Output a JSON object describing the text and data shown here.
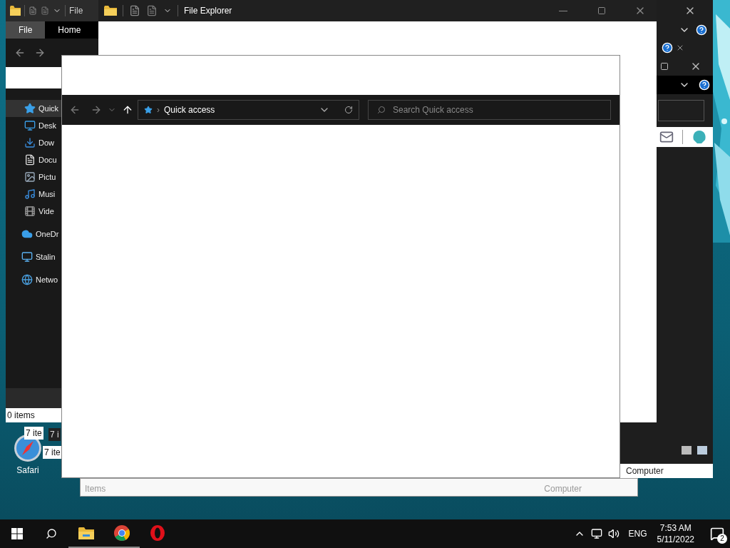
{
  "back_window": {
    "title": "File",
    "ribbon_tabs": [
      {
        "label": "File",
        "selected": true
      },
      {
        "label": "Home",
        "selected": false
      }
    ],
    "nav_items": [
      {
        "label": "Quick",
        "kind": "star",
        "selected": true
      },
      {
        "label": "Desk",
        "kind": "desktop",
        "selected": false
      },
      {
        "label": "Dow",
        "kind": "download",
        "selected": false
      },
      {
        "label": "Docu",
        "kind": "document",
        "selected": false
      },
      {
        "label": "Pictu",
        "kind": "pictures",
        "selected": false
      },
      {
        "label": "Musi",
        "kind": "music",
        "selected": false
      },
      {
        "label": "Vide",
        "kind": "video",
        "selected": false
      },
      {
        "label": "OneDr",
        "kind": "cloud",
        "selected": false
      },
      {
        "label": "Stalin",
        "kind": "computer",
        "selected": false
      },
      {
        "label": "Netwo",
        "kind": "network",
        "selected": false
      }
    ],
    "status": "0 items"
  },
  "middle_window": {
    "title": "File Explorer"
  },
  "right_window": {
    "status": "Computer"
  },
  "bottom_window": {
    "status_left": "Items",
    "status_right": "Computer"
  },
  "item_counts": [
    {
      "text": "7 ite",
      "dark": false
    },
    {
      "text": "7 i",
      "dark": true
    },
    {
      "text": "7 ite",
      "dark": false
    }
  ],
  "front_window": {
    "separator": "›",
    "address": "Quick access",
    "search": {
      "placeholder": "Search Quick access"
    }
  },
  "desktop_icons": [
    {
      "label": "Safari"
    }
  ],
  "taskbar": {
    "apps": [
      {
        "kind": "explorer",
        "running": true
      },
      {
        "kind": "chrome",
        "running": true
      },
      {
        "kind": "opera",
        "running": false
      }
    ],
    "language": "ENG",
    "time": "7:53 AM",
    "date": "5/11/2022",
    "notification_count": "2"
  }
}
